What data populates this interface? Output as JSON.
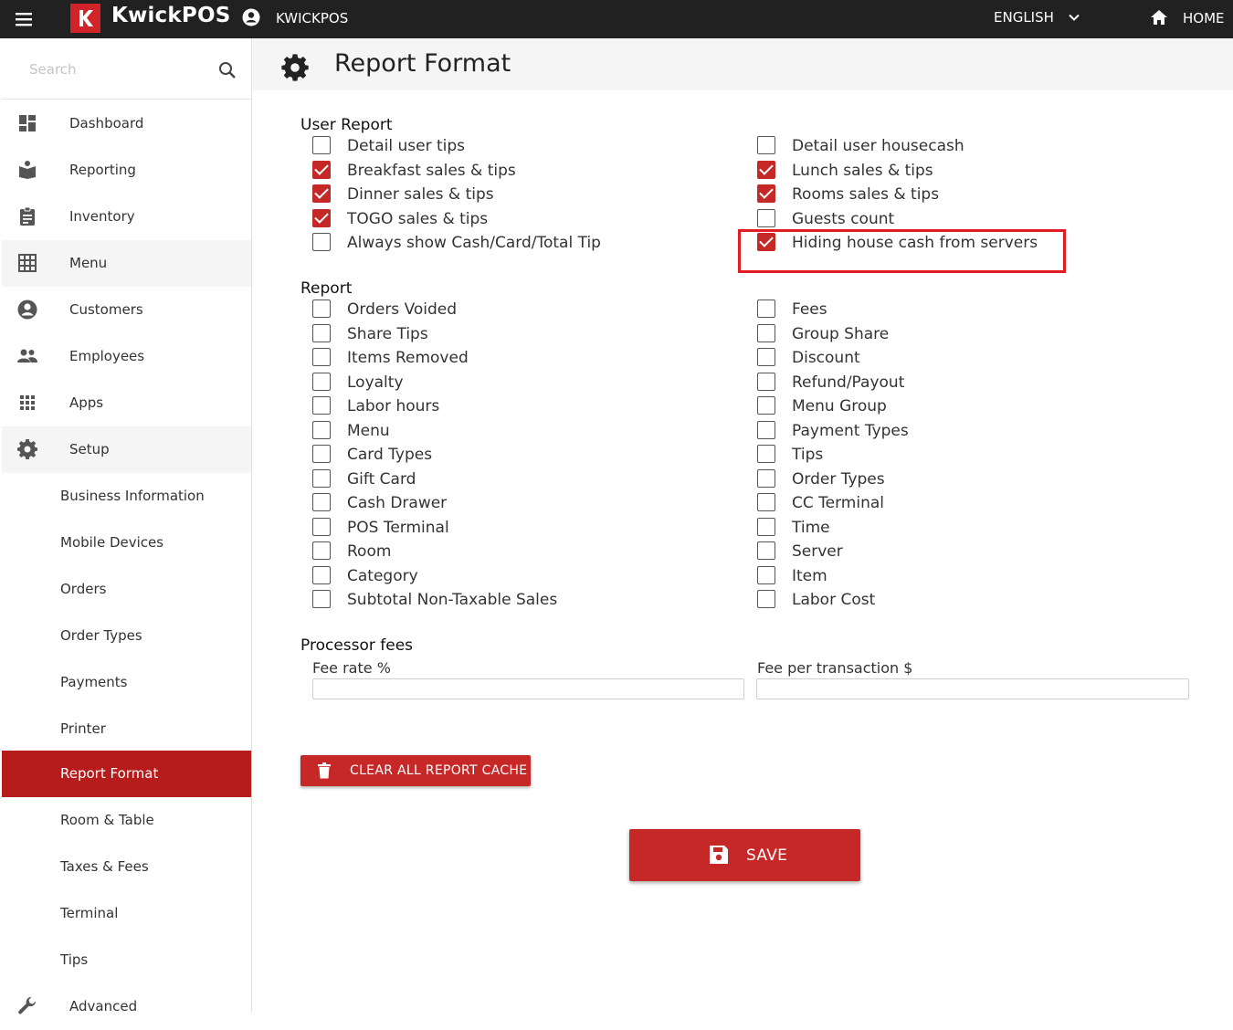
{
  "app": {
    "brand": "KwickPOS",
    "account_name": "KWICKPOS",
    "language": "ENGLISH",
    "home_label": "HOME",
    "accent_color": "#c62828"
  },
  "sidebar": {
    "search_placeholder": "Search",
    "items": [
      {
        "label": "Dashboard",
        "icon": "dashboard-icon"
      },
      {
        "label": "Reporting",
        "icon": "reporting-icon"
      },
      {
        "label": "Inventory",
        "icon": "clipboard-icon"
      },
      {
        "label": "Menu",
        "icon": "grid-icon"
      },
      {
        "label": "Customers",
        "icon": "account-icon"
      },
      {
        "label": "Employees",
        "icon": "people-icon"
      },
      {
        "label": "Apps",
        "icon": "apps-icon"
      },
      {
        "label": "Setup",
        "icon": "gear-icon"
      }
    ],
    "setup_items": [
      {
        "label": "Business Information"
      },
      {
        "label": "Mobile Devices"
      },
      {
        "label": "Orders"
      },
      {
        "label": "Order Types"
      },
      {
        "label": "Payments"
      },
      {
        "label": "Printer"
      },
      {
        "label": "Report Format",
        "active": true
      },
      {
        "label": "Room & Table"
      },
      {
        "label": "Taxes & Fees"
      },
      {
        "label": "Terminal"
      },
      {
        "label": "Tips"
      }
    ],
    "advanced_label": "Advanced"
  },
  "page": {
    "title": "Report Format"
  },
  "user_report": {
    "title": "User Report",
    "left": [
      {
        "label": "Detail user tips",
        "checked": false
      },
      {
        "label": "Breakfast sales & tips",
        "checked": true
      },
      {
        "label": "Dinner sales & tips",
        "checked": true
      },
      {
        "label": "TOGO sales & tips",
        "checked": true
      },
      {
        "label": "Always show Cash/Card/Total Tip",
        "checked": false
      }
    ],
    "right": [
      {
        "label": "Detail user housecash",
        "checked": false
      },
      {
        "label": "Lunch sales & tips",
        "checked": true
      },
      {
        "label": "Rooms sales & tips",
        "checked": true
      },
      {
        "label": "Guests count",
        "checked": false
      },
      {
        "label": "Hiding house cash from servers",
        "checked": true
      }
    ]
  },
  "report": {
    "title": "Report",
    "left": [
      {
        "label": "Orders Voided",
        "checked": false
      },
      {
        "label": "Share Tips",
        "checked": false
      },
      {
        "label": "Items Removed",
        "checked": false
      },
      {
        "label": "Loyalty",
        "checked": false
      },
      {
        "label": "Labor hours",
        "checked": false
      },
      {
        "label": "Menu",
        "checked": false
      },
      {
        "label": "Card Types",
        "checked": false
      },
      {
        "label": "Gift Card",
        "checked": false
      },
      {
        "label": "Cash Drawer",
        "checked": false
      },
      {
        "label": "POS Terminal",
        "checked": false
      },
      {
        "label": "Room",
        "checked": false
      },
      {
        "label": "Category",
        "checked": false
      },
      {
        "label": "Subtotal Non-Taxable Sales",
        "checked": false
      }
    ],
    "right": [
      {
        "label": "Fees",
        "checked": false
      },
      {
        "label": "Group Share",
        "checked": false
      },
      {
        "label": "Discount",
        "checked": false
      },
      {
        "label": "Refund/Payout",
        "checked": false
      },
      {
        "label": "Menu Group",
        "checked": false
      },
      {
        "label": "Payment Types",
        "checked": false
      },
      {
        "label": "Tips",
        "checked": false
      },
      {
        "label": "Order Types",
        "checked": false
      },
      {
        "label": "CC Terminal",
        "checked": false
      },
      {
        "label": "Time",
        "checked": false
      },
      {
        "label": "Server",
        "checked": false
      },
      {
        "label": "Item",
        "checked": false
      },
      {
        "label": "Labor Cost",
        "checked": false
      }
    ]
  },
  "processor_fees": {
    "title": "Processor fees",
    "fee_rate_label": "Fee rate %",
    "fee_rate_value": "",
    "fee_per_tx_label": "Fee per transaction $",
    "fee_per_tx_value": ""
  },
  "actions": {
    "clear_cache_label": "CLEAR ALL REPORT CACHE",
    "save_label": "SAVE"
  }
}
